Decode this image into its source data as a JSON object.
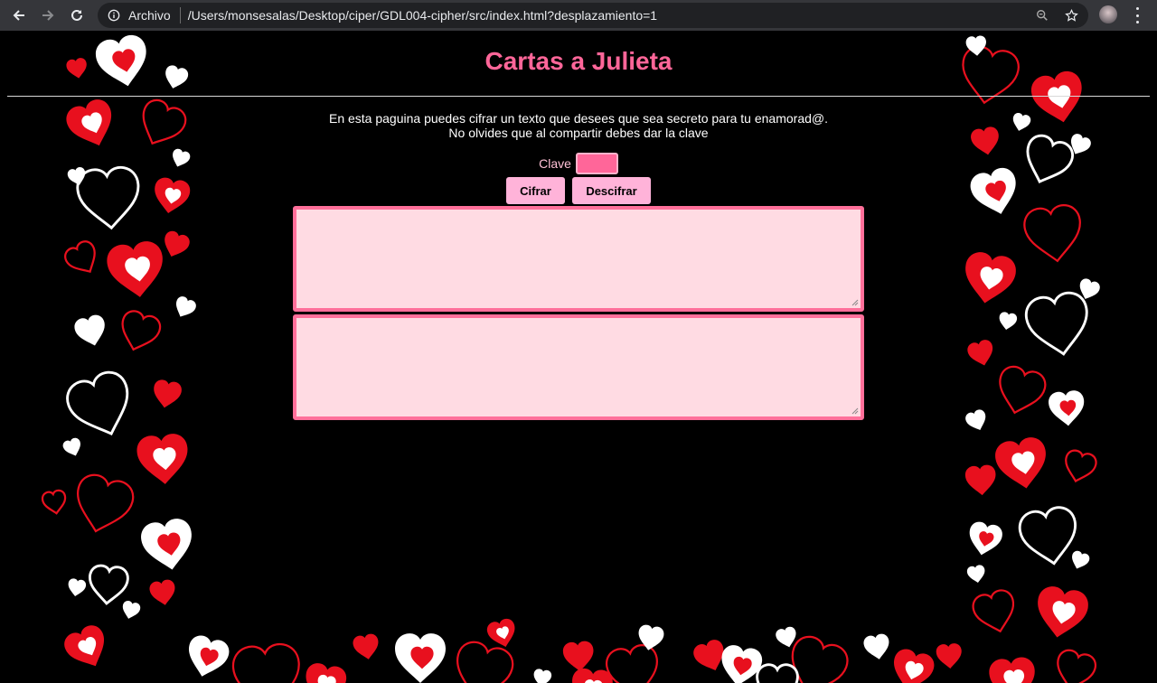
{
  "browser": {
    "security_label": "Archivo",
    "url": "/Users/monsesalas/Desktop/ciper/GDL004-cipher/src/index.html?desplazamiento=1"
  },
  "page": {
    "title": "Cartas a Julieta",
    "intro_line1": "En esta paguina puedes cifrar un texto que desees que sea secreto para tu enamorad@.",
    "intro_line2": "No olvides que al compartir debes dar la clave",
    "key_label": "Clave",
    "key_value": "",
    "encrypt_label": "Cifrar",
    "decrypt_label": "Descifrar",
    "input_text": "",
    "output_text": ""
  },
  "colors": {
    "title": "#ff6699",
    "button_bg": "#ffb3d9",
    "textarea_bg": "#ffdbe3",
    "textarea_border": "#ff6f9a",
    "heart_red": "#e8101e",
    "heart_white": "#ffffff"
  },
  "icons": [
    "back-arrow-icon",
    "forward-arrow-icon",
    "reload-icon",
    "info-icon",
    "zoom-icon",
    "star-icon",
    "profile-avatar",
    "menu-kebab-icon"
  ]
}
